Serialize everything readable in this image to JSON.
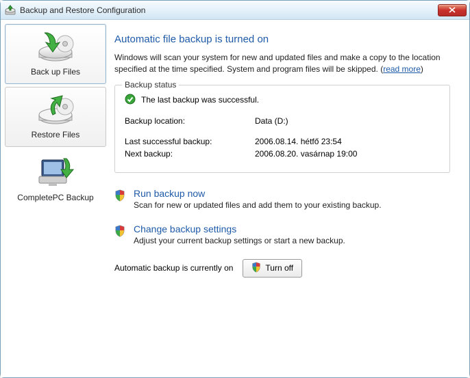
{
  "window": {
    "title": "Backup and Restore Configuration"
  },
  "sidebar": {
    "items": [
      {
        "label": "Back up Files"
      },
      {
        "label": "Restore Files"
      },
      {
        "label": "CompletePC Backup"
      }
    ]
  },
  "main": {
    "heading": "Automatic file backup is turned on",
    "description": "Windows will scan your system for new and updated files and make a copy to the location specified at the time specified. System and program files will be skipped.",
    "read_more": "read more",
    "status_group": {
      "legend": "Backup status",
      "status_text": "The last backup was successful.",
      "rows": {
        "location_key": "Backup location:",
        "location_val": "Data (D:)",
        "last_key": "Last successful backup:",
        "last_val": "2006.08.14. hétfő 23:54",
        "next_key": "Next backup:",
        "next_val": "2006.08.20. vasárnap 19:00"
      }
    },
    "actions": {
      "run_now": {
        "title": "Run backup now",
        "sub": "Scan for new or updated files and add them to your existing backup."
      },
      "change": {
        "title": "Change backup settings",
        "sub": "Adjust your current backup settings or start a new backup."
      }
    },
    "footer": {
      "label": "Automatic backup is currently on",
      "button": "Turn off"
    }
  },
  "colors": {
    "accent": "#1e5aa8"
  }
}
